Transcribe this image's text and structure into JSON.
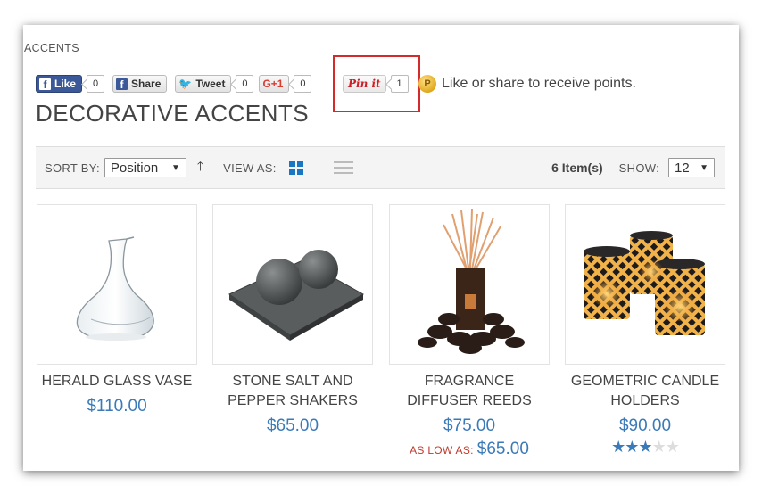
{
  "breadcrumb": "ACCENTS",
  "social": {
    "like_label": "Like",
    "like_count": "0",
    "share_label": "Share",
    "tweet_label": "Tweet",
    "tweet_count": "0",
    "gplus_label": "G+1",
    "gplus_count": "0",
    "pin_label": "Pin it",
    "pin_count": "1",
    "points_text": "Like or share to receive points."
  },
  "page_title": "DECORATIVE ACCENTS",
  "toolbar": {
    "sort_label": "SORT BY:",
    "sort_value": "Position",
    "view_label": "VIEW AS:",
    "items_count": "6 Item(s)",
    "show_label": "SHOW:",
    "show_value": "12"
  },
  "products": [
    {
      "name": "HERALD GLASS VASE",
      "price": "$110.00"
    },
    {
      "name": "STONE SALT AND PEPPER SHAKERS",
      "price": "$65.00"
    },
    {
      "name": "FRAGRANCE DIFFUSER REEDS",
      "price": "$75.00",
      "as_low_as_label": "AS LOW AS:",
      "as_low_as_price": "$65.00"
    },
    {
      "name": "GEOMETRIC CANDLE HOLDERS",
      "price": "$90.00",
      "rating": 3,
      "rating_max": 5
    }
  ],
  "colors": {
    "accent_blue": "#3a7ab8",
    "facebook": "#3b5998",
    "highlight": "#d42a2a",
    "low_as_red": "#c0392b"
  }
}
